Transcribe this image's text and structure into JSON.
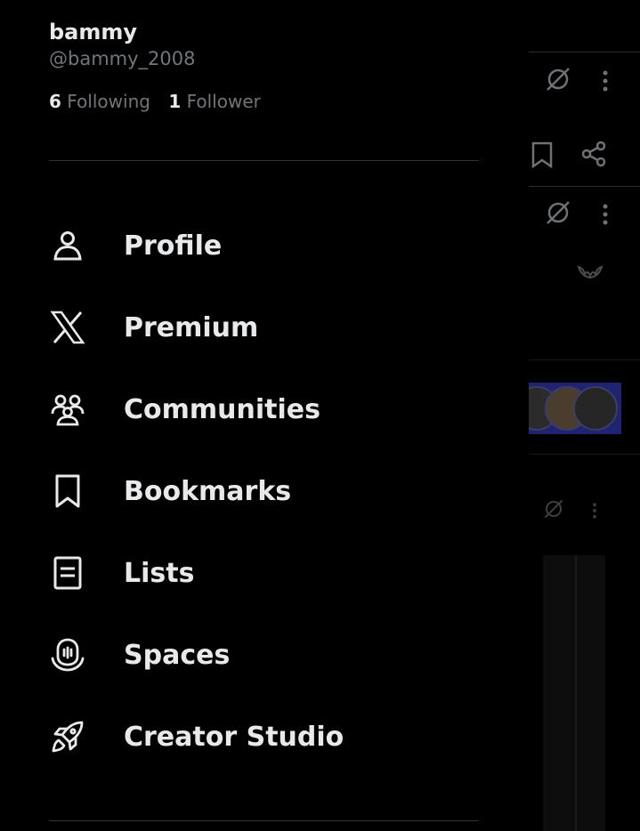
{
  "profile": {
    "display_name": "bammy",
    "handle": "@bammy_2008",
    "following_count": "6",
    "following_label": "Following",
    "followers_count": "1",
    "followers_label": "Follower"
  },
  "menu": [
    {
      "label": "Profile",
      "icon": "person-icon"
    },
    {
      "label": "Premium",
      "icon": "x-logo-icon"
    },
    {
      "label": "Communities",
      "icon": "communities-icon"
    },
    {
      "label": "Bookmarks",
      "icon": "bookmark-icon"
    },
    {
      "label": "Lists",
      "icon": "lists-icon"
    },
    {
      "label": "Spaces",
      "icon": "spaces-icon"
    },
    {
      "label": "Creator Studio",
      "icon": "rocket-icon"
    }
  ],
  "background_feed": {
    "icons": [
      "grok-icon",
      "more-icon",
      "bookmark-icon",
      "share-icon"
    ]
  },
  "colors": {
    "background": "#000000",
    "primary_text": "#e7e9ea",
    "secondary_text": "#71767b",
    "divider": "#2f3336"
  }
}
